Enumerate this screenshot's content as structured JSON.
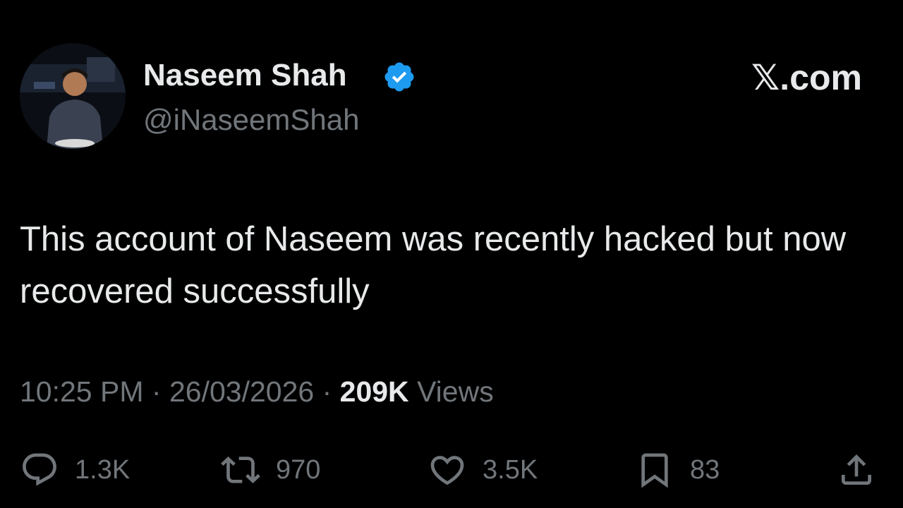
{
  "author": {
    "display_name": "Naseem Shah",
    "handle": "@iNaseemShah",
    "verified": true
  },
  "brand": "𝕏.com",
  "post": {
    "text": "This account of Naseem was recently hacked but now recovered successfully"
  },
  "meta": {
    "time": "10:25 PM",
    "separator": "·",
    "date": "26/03/2026",
    "views_count": "209K",
    "views_label": "Views"
  },
  "actions": {
    "reply_count": "1.3K",
    "repost_count": "970",
    "like_count": "3.5K",
    "bookmark_count": "83"
  },
  "colors": {
    "background": "#000000",
    "primary_text": "#e7e9ea",
    "secondary_text": "#71767b",
    "verified_badge": "#1d9bf0"
  },
  "icons": [
    "verified-badge-icon",
    "reply-icon",
    "repost-icon",
    "like-icon",
    "bookmark-icon",
    "share-icon"
  ]
}
